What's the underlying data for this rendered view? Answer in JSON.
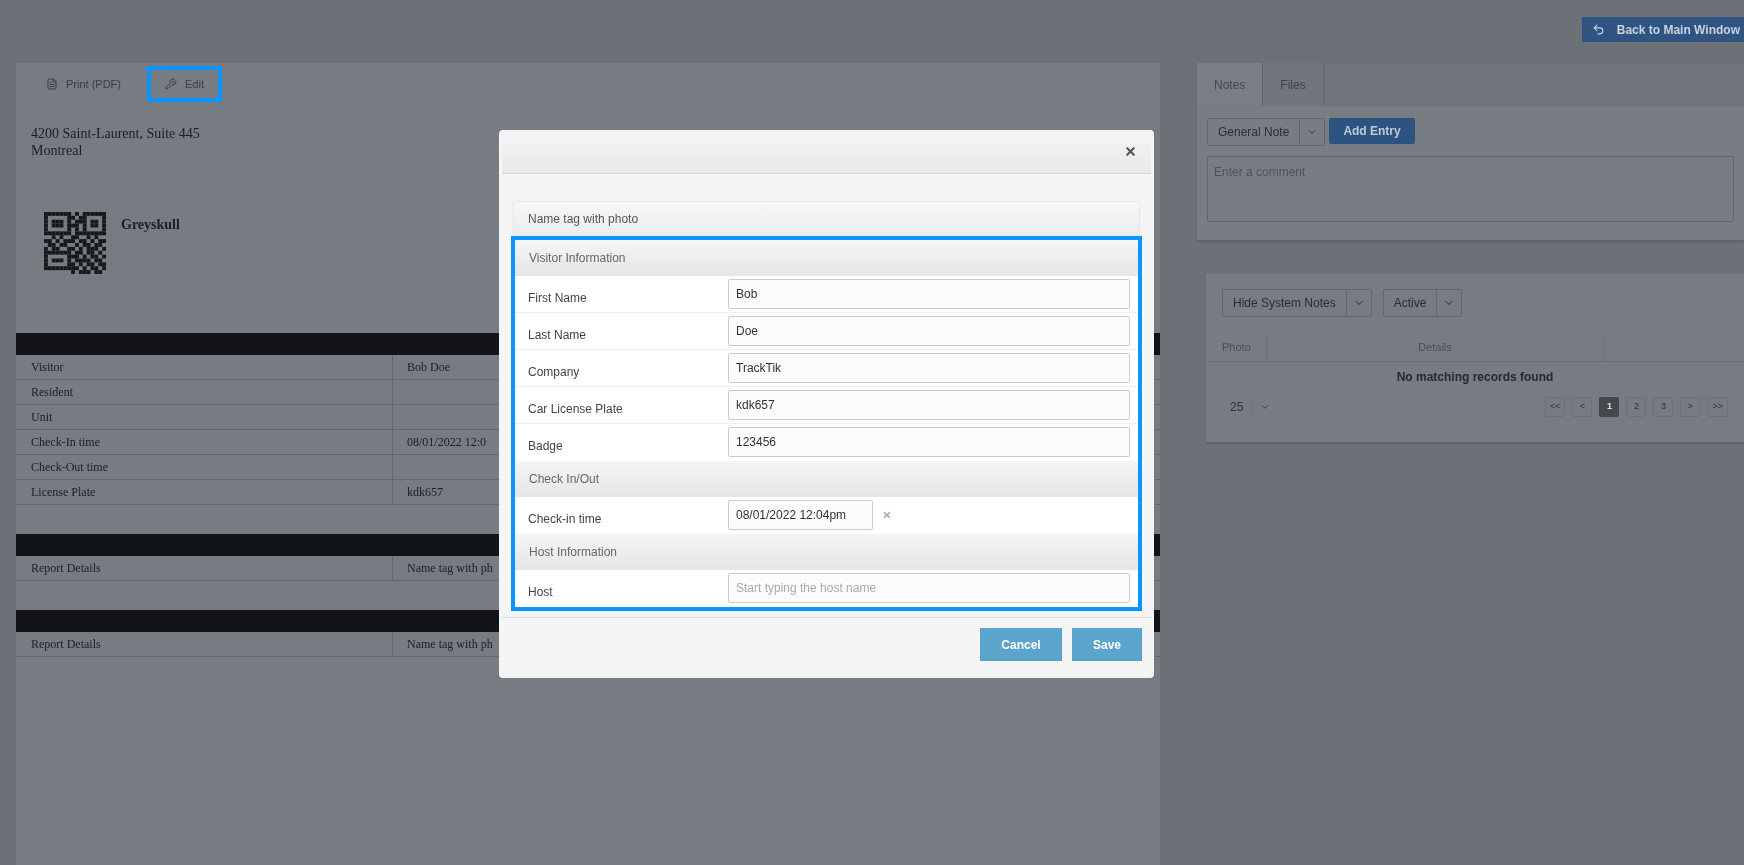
{
  "top_bar": {
    "back_button": "Back to Main Window"
  },
  "report": {
    "toolbar": [
      {
        "label": "Print (PDF)",
        "kind": "pdf",
        "highlighted": false
      },
      {
        "label": "Edit",
        "kind": "edit",
        "highlighted": true
      }
    ],
    "address": [
      "4200 Saint-Laurent, Suite 445",
      "Montreal"
    ],
    "site_name": "Greyskull",
    "tables": [
      {
        "rows": [
          [
            "Visitor",
            "Bob Doe"
          ],
          [
            "Resident",
            ""
          ],
          [
            "Unit",
            ""
          ],
          [
            "Check-In time",
            "08/01/2022 12:0"
          ],
          [
            "Check-Out time",
            ""
          ],
          [
            "License Plate",
            "kdk657"
          ]
        ]
      },
      {
        "rows": [
          [
            "Report Details",
            "Name tag with ph"
          ]
        ]
      },
      {
        "rows": [
          [
            "Report Details",
            "Name tag with ph"
          ]
        ]
      }
    ]
  },
  "side_panel": {
    "tabs": [
      {
        "label": "Notes",
        "selected": true
      },
      {
        "label": "Files",
        "selected": false
      }
    ],
    "note_type": "General Note",
    "add_button": "Add Entry",
    "comment": {
      "placeholder": "Enter a comment"
    },
    "filters": [
      "Hide System Notes",
      "Active"
    ],
    "table": {
      "columns": [
        "Photo",
        "Details"
      ],
      "empty_message": "No matching records found"
    },
    "page_size": "25",
    "pagination": [
      {
        "label": "<<",
        "selected": false
      },
      {
        "label": "<",
        "selected": false
      },
      {
        "label": "1",
        "selected": true
      },
      {
        "label": "2",
        "selected": false
      },
      {
        "label": "3",
        "selected": false
      },
      {
        "label": ">",
        "selected": false
      },
      {
        "label": ">>",
        "selected": false
      }
    ]
  },
  "dialog": {
    "subtitle": "Name tag with photo",
    "highlighted": true,
    "groups": [
      {
        "title": "Visitor Information",
        "fields": [
          {
            "label": "First Name",
            "value": "Bob",
            "kind": "text"
          },
          {
            "label": "Last Name",
            "value": "Doe",
            "kind": "text"
          },
          {
            "label": "Company",
            "value": "TrackTik",
            "kind": "text"
          },
          {
            "label": "Car License Plate",
            "value": "kdk657",
            "kind": "text"
          },
          {
            "label": "Badge",
            "value": "123456",
            "kind": "text"
          }
        ]
      },
      {
        "title": "Check In/Out",
        "fields": [
          {
            "label": "Check-in time",
            "value": "08/01/2022 12:04pm",
            "kind": "datetime"
          }
        ]
      },
      {
        "title": "Host Information",
        "fields": [
          {
            "label": "Host",
            "placeholder": "Start typing the host name",
            "kind": "text"
          }
        ]
      }
    ],
    "buttons": [
      "Cancel",
      "Save"
    ]
  }
}
